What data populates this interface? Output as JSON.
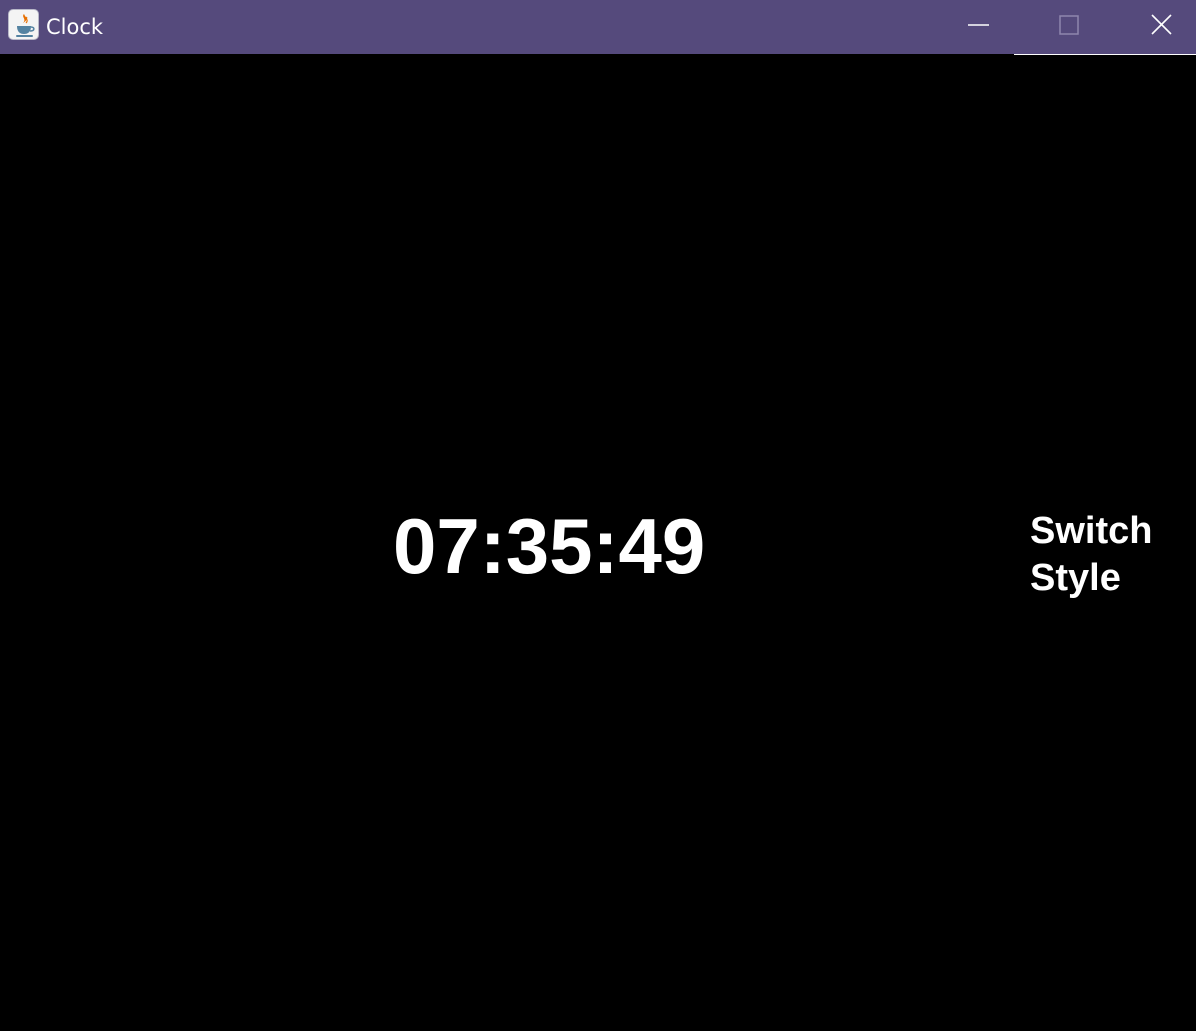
{
  "window": {
    "title": "Clock",
    "app_icon": "java-icon",
    "titlebar_color": "#554a7c",
    "controls": [
      "minimize-icon",
      "maximize-icon",
      "close-icon"
    ]
  },
  "clock": {
    "time": "07:35:49",
    "text_color": "#ffffff",
    "background_color": "#000000"
  },
  "switch_button": {
    "line1": "Switch",
    "line2": "Style"
  }
}
